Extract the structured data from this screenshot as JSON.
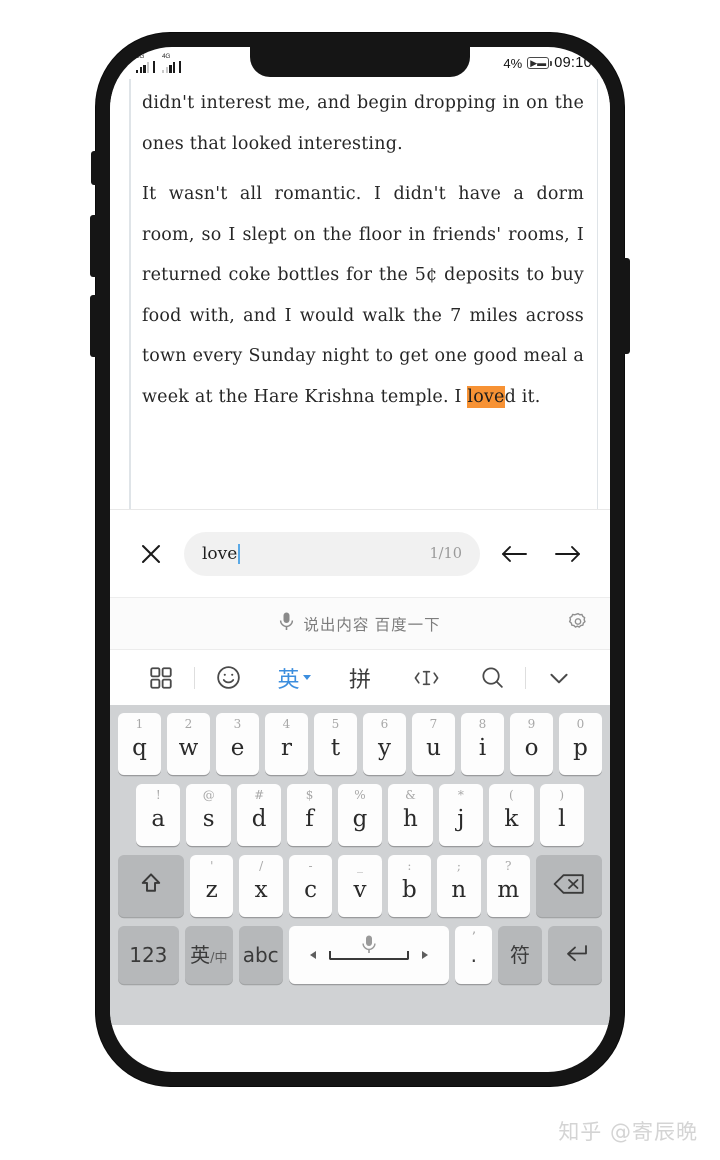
{
  "status_bar": {
    "signal_1_network": "2G",
    "signal_2_network": "4G",
    "battery_percent": "4%",
    "battery_icon": "battery-charging-icon",
    "clock": "09:10"
  },
  "reader": {
    "paragraphs": [
      {
        "id": "para-1",
        "segments": [
          {
            "text": "didn't interest me, and begin dropping in on the ones that looked interesting.",
            "highlight": false
          }
        ]
      },
      {
        "id": "para-2",
        "segments": [
          {
            "text": "It wasn't all romantic. I didn't have a dorm room, so I slept on the floor in friends' rooms, I returned coke bottles for the 5¢ deposits to buy food with, and I would walk the 7 miles across town every Sunday night to get one good meal a week at the Hare Krishna temple. I ",
            "highlight": false
          },
          {
            "text": "love",
            "highlight": true
          },
          {
            "text": "d it.",
            "highlight": false
          }
        ]
      }
    ],
    "highlight_color": "#f79234"
  },
  "find_bar": {
    "close_icon": "close-icon",
    "query_value": "love",
    "query_placeholder": "",
    "match_counter": "1/10",
    "prev_icon": "arrow-left-icon",
    "next_icon": "arrow-right-icon",
    "caret_color": "#5aa9e6"
  },
  "voice_bar": {
    "mic_icon": "microphone-icon",
    "prompt": "说出内容 百度一下",
    "settings_icon": "gear-icon"
  },
  "keyboard_toolbar": {
    "items": [
      {
        "name": "apps-grid-icon",
        "label": "",
        "kind": "icon",
        "active": false
      },
      {
        "name": "toolbar-divider-1",
        "label": "",
        "kind": "divider",
        "active": false
      },
      {
        "name": "emoji-icon",
        "label": "",
        "kind": "icon",
        "active": false
      },
      {
        "name": "language-english-button",
        "label": "英",
        "kind": "text",
        "active": true
      },
      {
        "name": "pinyin-button",
        "label": "拼",
        "kind": "text",
        "active": false
      },
      {
        "name": "cursor-move-icon",
        "label": "",
        "kind": "icon",
        "active": false
      },
      {
        "name": "search-icon",
        "label": "",
        "kind": "icon",
        "active": false
      },
      {
        "name": "toolbar-divider-2",
        "label": "",
        "kind": "divider",
        "active": false
      },
      {
        "name": "collapse-keyboard-icon",
        "label": "",
        "kind": "icon",
        "active": false
      }
    ],
    "active_color": "#3c8ede"
  },
  "keyboard": {
    "row1": [
      {
        "key": "q",
        "hint": "1"
      },
      {
        "key": "w",
        "hint": "2"
      },
      {
        "key": "e",
        "hint": "3"
      },
      {
        "key": "r",
        "hint": "4"
      },
      {
        "key": "t",
        "hint": "5"
      },
      {
        "key": "y",
        "hint": "6"
      },
      {
        "key": "u",
        "hint": "7"
      },
      {
        "key": "i",
        "hint": "8"
      },
      {
        "key": "o",
        "hint": "9"
      },
      {
        "key": "p",
        "hint": "0"
      }
    ],
    "row2": [
      {
        "key": "a",
        "hint": "!"
      },
      {
        "key": "s",
        "hint": "@"
      },
      {
        "key": "d",
        "hint": "#"
      },
      {
        "key": "f",
        "hint": "$"
      },
      {
        "key": "g",
        "hint": "%"
      },
      {
        "key": "h",
        "hint": "&"
      },
      {
        "key": "j",
        "hint": "*"
      },
      {
        "key": "k",
        "hint": "("
      },
      {
        "key": "l",
        "hint": ")"
      }
    ],
    "row3": [
      {
        "key": "z",
        "hint": "'"
      },
      {
        "key": "x",
        "hint": "/"
      },
      {
        "key": "c",
        "hint": "-"
      },
      {
        "key": "v",
        "hint": "_"
      },
      {
        "key": "b",
        "hint": ":"
      },
      {
        "key": "n",
        "hint": ";"
      },
      {
        "key": "m",
        "hint": "?"
      }
    ],
    "shift_label": "shift-icon",
    "backspace_label": "backspace-icon",
    "row4": {
      "numbers_label": "123",
      "lang_label": "英",
      "lang_sub_label": "/中",
      "abc_label": "abc",
      "space_mic_icon": "microphone-icon",
      "period_label": ".",
      "period_hint": "’",
      "symbols_label": "符",
      "enter_label": "enter-icon"
    }
  },
  "watermark": {
    "text": "知乎 @寄辰晩"
  }
}
